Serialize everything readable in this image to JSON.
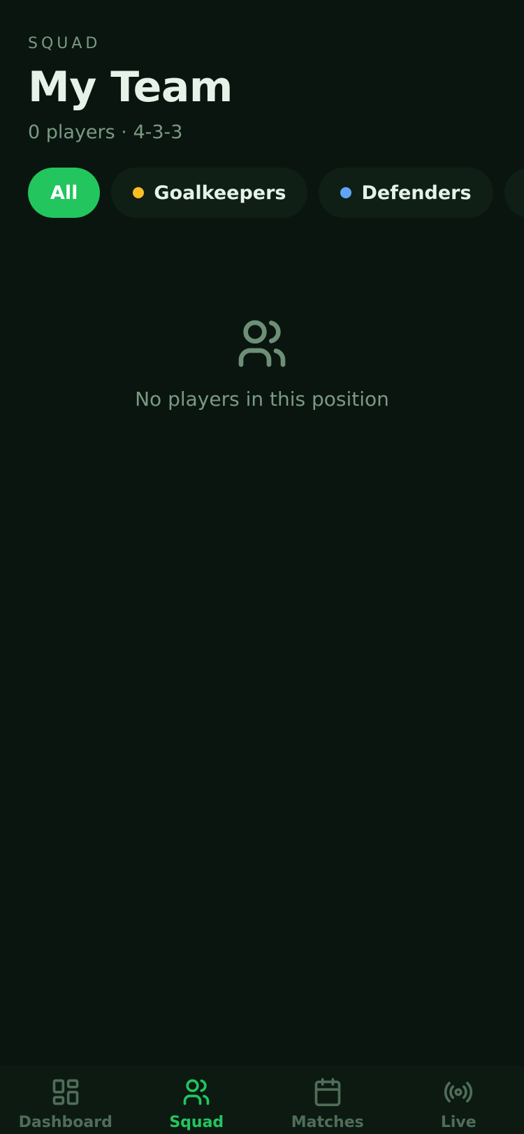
{
  "header": {
    "eyebrow": "SQUAD",
    "title": "My Team",
    "subtitle": "0 players · 4-3-3"
  },
  "filters": {
    "items": [
      {
        "label": "All",
        "active": true
      },
      {
        "label": "Goalkeepers",
        "dot_color": "#fbbf24"
      },
      {
        "label": "Defenders",
        "dot_color": "#60a5fa"
      },
      {
        "label": "",
        "dot_color": "#4ade80"
      }
    ]
  },
  "empty_state": {
    "icon": "users-icon",
    "text": "No players in this position"
  },
  "tabbar": {
    "items": [
      {
        "label": "Dashboard",
        "icon": "dashboard-icon"
      },
      {
        "label": "Squad",
        "icon": "users-icon",
        "active": true
      },
      {
        "label": "Matches",
        "icon": "calendar-icon"
      },
      {
        "label": "Live",
        "icon": "broadcast-icon"
      }
    ]
  },
  "colors": {
    "background": "#0a150f",
    "accent": "#22c55e",
    "muted": "#7a9a83"
  }
}
